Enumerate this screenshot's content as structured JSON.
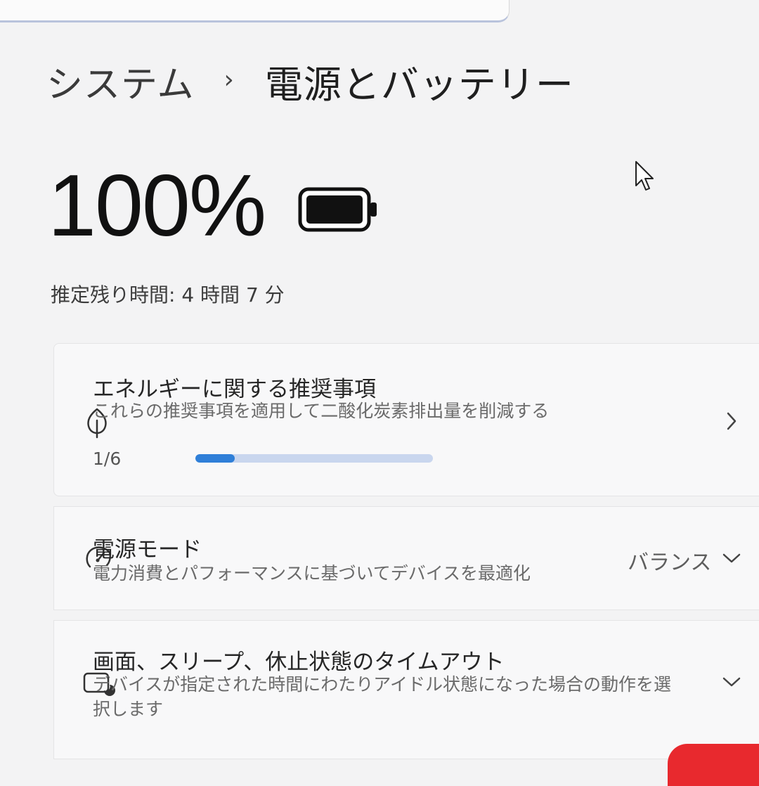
{
  "breadcrumb": {
    "parent": "システム",
    "separator": "›",
    "current": "電源とバッテリー"
  },
  "battery": {
    "percent_label": "100%",
    "level": 1.0,
    "remaining_label": "推定残り時間: 4 時間 7 分"
  },
  "cards": {
    "energy": {
      "icon": "leaf-icon",
      "title": "エネルギーに関する推奨事項",
      "description": "これらの推奨事項を適用して二酸化炭素排出量を削減する",
      "progress_label": "1/6",
      "progress_value": 0.16667,
      "chevron": "chevron-right-icon"
    },
    "power_mode": {
      "icon": "speedometer-icon",
      "title": "電源モード",
      "description": "電力消費とパフォーマンスに基づいてデバイスを最適化",
      "selected_value": "バランス",
      "chevron": "chevron-down-icon"
    },
    "sleep": {
      "icon": "screen-sleep-icon",
      "title": "画面、スリープ、休止状態のタイムアウト",
      "description_line1": "デバイスが指定された時間にわたりアイドル状態になった場合の動作を選",
      "description_line2": "択します",
      "chevron": "chevron-down-icon"
    }
  },
  "colors": {
    "accent": "#2f7fd8",
    "progress_track": "#c9d6ee",
    "background": "#f3f3f4",
    "card": "#f8f8f9"
  }
}
